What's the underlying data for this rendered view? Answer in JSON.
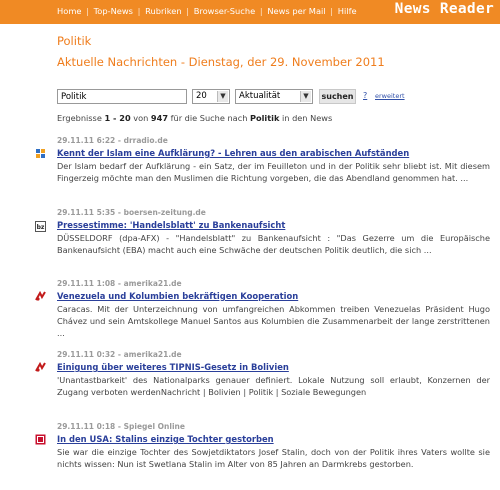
{
  "nav": {
    "items": [
      "Home",
      "Top-News",
      "Rubriken",
      "Browser-Suche",
      "News per Mail",
      "Hilfe"
    ],
    "brand": "News Reader"
  },
  "page": {
    "title": "Politik",
    "subtitle": "Aktuelle Nachrichten - Dienstag, der 29. November 2011"
  },
  "search": {
    "query": "Politik",
    "count_value": "20",
    "sort_value": "Aktualität",
    "button_label": "suchen",
    "help_label": "?",
    "advanced_label": "erweitert"
  },
  "summary": {
    "prefix": "Ergebnisse ",
    "range": "1 - 20",
    "middle": " von ",
    "total": "947",
    "for": " für die Suche nach ",
    "term": "Politik",
    "suffix": " in den News"
  },
  "articles": [
    {
      "meta": "29.11.11 6:22 - drradio.de",
      "title": "Kennt der Islam eine Aufklärung? - Lehren aus den arabischen Aufständen",
      "snippet": "Der Islam bedarf der Aufklärung - ein Satz, der im Feuilleton und in der Politik sehr bliebt ist. Mit diesem Fingerzeig möchte man den Muslimen die Richtung vorgeben, die das Abendland genommen hat. ...",
      "icon": "drradio-source-icon"
    },
    {
      "meta": "29.11.11 5:35 - boersen-zeitung.de",
      "title": "Pressestimme: 'Handelsblatt' zu Bankenaufsicht",
      "snippet": "DÜSSELDORF (dpa-AFX) - \"Handelsblatt\" zu Bankenaufsicht : \"Das Gezerre um die Europäische Bankenaufsicht (EBA) macht auch eine Schwäche der deutschen Politik deutlich, die sich ...",
      "icon": "boersen-zeitung-source-icon"
    },
    {
      "meta": "29.11.11 1:08 - amerika21.de",
      "title": "Venezuela und Kolumbien bekräftigen Kooperation",
      "snippet": "Caracas. Mit der Unterzeichnung von umfangreichen Abkommen treiben Venezuelas Präsident Hugo Chávez und sein Amtskollege Manuel Santos aus Kolumbien die Zusammenarbeit der lange zerstrittenen ...",
      "icon": "amerika21-source-icon"
    },
    {
      "meta": "29.11.11 0:32 - amerika21.de",
      "title": "Einigung über weiteres TIPNIS-Gesetz in Bolivien",
      "snippet": "'Unantastbarkeit' des Nationalparks genauer definiert. Lokale Nutzung soll erlaubt, Konzernen der Zugang verboten werdenNachricht | Bolivien | Politik | Soziale Bewegungen",
      "icon": "amerika21-source-icon"
    },
    {
      "meta": "29.11.11 0:18 - Spiegel Online",
      "title": "In den USA: Stalins einzige Tochter gestorben",
      "snippet": "Sie war die einzige Tochter des Sowjetdiktators Josef Stalin, doch von der Politik ihres Vaters wollte sie nichts wissen: Nun ist Swetlana Stalin im Alter von 85 Jahren an Darmkrebs gestorben.",
      "icon": "spiegel-source-icon"
    }
  ],
  "colors": {
    "accent": "#f08a24",
    "heading": "#ef7d1d",
    "link": "#2a3f9a",
    "meta": "#9a9a9a"
  }
}
